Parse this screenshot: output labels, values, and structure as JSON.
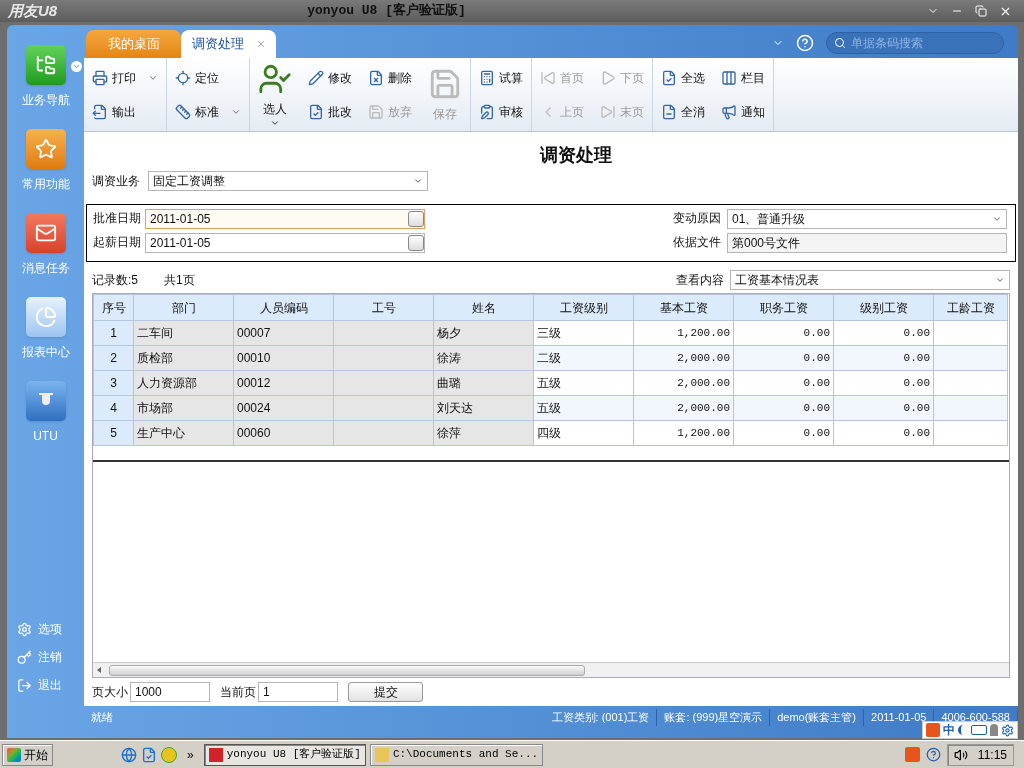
{
  "app": {
    "logo": "用友U8",
    "title": "yonyou U8 [客户验证版]"
  },
  "sidebar": {
    "items": [
      {
        "label": "业务导航",
        "dropdown": true
      },
      {
        "label": "常用功能",
        "dropdown": false
      },
      {
        "label": "消息任务",
        "dropdown": false
      },
      {
        "label": "报表中心",
        "dropdown": false
      },
      {
        "label": "UTU",
        "dropdown": false
      }
    ],
    "bottom": [
      {
        "label": "选项"
      },
      {
        "label": "注销"
      },
      {
        "label": "退出"
      }
    ]
  },
  "tabs": [
    {
      "label": "我的桌面",
      "selected": false,
      "closable": false
    },
    {
      "label": "调资处理",
      "selected": true,
      "closable": true
    }
  ],
  "search": {
    "placeholder": "单据条码搜索"
  },
  "toolbar": [
    {
      "kind": "pair",
      "items": [
        {
          "label": "打印",
          "disabled": false,
          "dropdown": true
        },
        {
          "label": "输出",
          "disabled": false,
          "dropdown": false
        }
      ]
    },
    {
      "kind": "pair",
      "items": [
        {
          "label": "定位",
          "disabled": false,
          "dropdown": false
        },
        {
          "label": "标准",
          "disabled": false,
          "dropdown": true
        }
      ]
    },
    {
      "kind": "big",
      "items": [
        {
          "label": "选人",
          "disabled": false,
          "dropdown": true
        }
      ]
    },
    {
      "kind": "pair",
      "items": [
        {
          "label": "修改",
          "disabled": false,
          "dropdown": false
        },
        {
          "label": "批改",
          "disabled": false,
          "dropdown": false
        }
      ]
    },
    {
      "kind": "pair",
      "items": [
        {
          "label": "删除",
          "disabled": false,
          "dropdown": false
        },
        {
          "label": "放弃",
          "disabled": true,
          "dropdown": false
        }
      ]
    },
    {
      "kind": "big",
      "items": [
        {
          "label": "保存",
          "disabled": true,
          "dropdown": false
        }
      ]
    },
    {
      "kind": "pair",
      "items": [
        {
          "label": "试算",
          "disabled": false,
          "dropdown": false
        },
        {
          "label": "审核",
          "disabled": false,
          "dropdown": false
        }
      ]
    },
    {
      "kind": "pair",
      "items": [
        {
          "label": "首页",
          "disabled": true,
          "dropdown": false
        },
        {
          "label": "上页",
          "disabled": true,
          "dropdown": false
        }
      ]
    },
    {
      "kind": "pair",
      "items": [
        {
          "label": "下页",
          "disabled": true,
          "dropdown": false
        },
        {
          "label": "末页",
          "disabled": true,
          "dropdown": false
        }
      ]
    },
    {
      "kind": "pair",
      "items": [
        {
          "label": "全选",
          "disabled": false,
          "dropdown": false
        },
        {
          "label": "全消",
          "disabled": false,
          "dropdown": false
        }
      ]
    },
    {
      "kind": "pair",
      "items": [
        {
          "label": "栏目",
          "disabled": false,
          "dropdown": false
        },
        {
          "label": "通知",
          "disabled": false,
          "dropdown": false
        }
      ]
    }
  ],
  "form": {
    "title": "调资处理",
    "business": {
      "label": "调资业务",
      "value": "固定工资调整"
    },
    "left": [
      {
        "label": "批准日期",
        "value": "2011-01-05",
        "focused": true
      },
      {
        "label": "起薪日期",
        "value": "2011-01-05",
        "focused": false
      }
    ],
    "right": [
      {
        "label": "变动原因",
        "value": "01、普通升级",
        "kind": "select"
      },
      {
        "label": "依据文件",
        "value": "第000号文件",
        "kind": "text"
      }
    ],
    "records": "记录数:5",
    "pages": "共1页",
    "view": {
      "label": "查看内容",
      "value": "工资基本情况表"
    }
  },
  "table": {
    "columns": [
      "序号",
      "部门",
      "人员编码",
      "工号",
      "姓名",
      "工资级别",
      "基本工资",
      "职务工资",
      "级别工资",
      "工龄工资"
    ],
    "rows": [
      [
        "1",
        "二车间",
        "00007",
        "",
        "杨夕",
        "三级",
        "1,200.00",
        "0.00",
        "0.00"
      ],
      [
        "2",
        "质检部",
        "00010",
        "",
        "徐涛",
        "二级",
        "2,000.00",
        "0.00",
        "0.00"
      ],
      [
        "3",
        "人力资源部",
        "00012",
        "",
        "曲璐",
        "五级",
        "2,000.00",
        "0.00",
        "0.00"
      ],
      [
        "4",
        "市场部",
        "00024",
        "",
        "刘天达",
        "五级",
        "2,000.00",
        "0.00",
        "0.00"
      ],
      [
        "5",
        "生产中心",
        "00060",
        "",
        "徐萍",
        "四级",
        "1,200.00",
        "0.00",
        "0.00"
      ]
    ]
  },
  "pager": {
    "size_label": "页大小",
    "size": "1000",
    "page_label": "当前页",
    "page": "1",
    "submit": "提交"
  },
  "status_bar": [
    "就绪",
    "工资类别: (001)工资",
    "账套: (999)星空演示",
    "demo(账套主管)",
    "2011-01-05",
    "4006-600-588"
  ],
  "ime": {
    "label": "中"
  },
  "taskbar": {
    "start": "开始",
    "more": "»",
    "tasks": [
      {
        "label": "yonyou U8 [客户验证版]",
        "selected": true
      },
      {
        "label": "C:\\Documents and Se...",
        "selected": false
      }
    ],
    "clock": "11:15"
  }
}
